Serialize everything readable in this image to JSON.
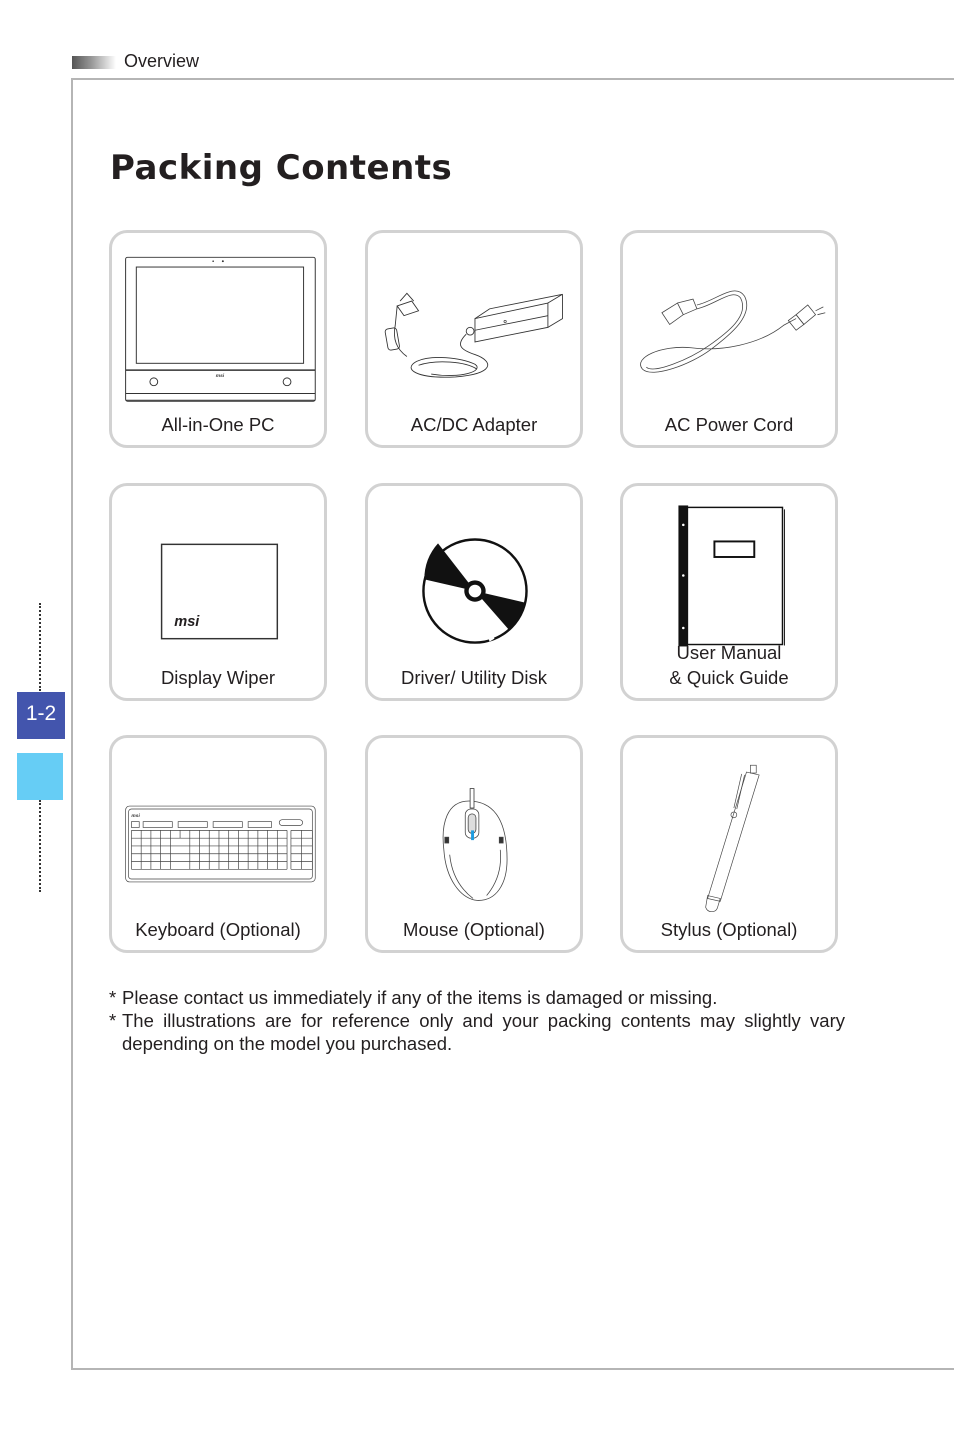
{
  "header": {
    "section_title": "Overview"
  },
  "page": {
    "title": "Packing Contents",
    "page_number": "1-2"
  },
  "items": [
    {
      "label": "All-in-One PC",
      "icon": "all-in-one-pc-icon"
    },
    {
      "label": "AC/DC Adapter",
      "icon": "ac-dc-adapter-icon"
    },
    {
      "label": "AC Power Cord",
      "icon": "ac-power-cord-icon"
    },
    {
      "label": "Display Wiper",
      "icon": "display-wiper-icon",
      "brand_text": "msi"
    },
    {
      "label": "Driver/ Utility Disk",
      "icon": "disk-icon"
    },
    {
      "label_line1": "User Manual",
      "label_line2": "& Quick Guide",
      "icon": "manual-icon"
    },
    {
      "label": "Keyboard (Optional)",
      "icon": "keyboard-icon"
    },
    {
      "label": "Mouse (Optional)",
      "icon": "mouse-icon"
    },
    {
      "label": "Stylus (Optional)",
      "icon": "stylus-icon"
    }
  ],
  "notes": [
    {
      "marker": "*",
      "text": "Please contact us immediately if any of the items is damaged or missing."
    },
    {
      "marker": "*",
      "text": "The illustrations are for reference only and your packing contents may slightly vary depending on the model you purchased."
    }
  ],
  "colors": {
    "page_tab": "#4355ad",
    "page_tab_accent": "#66cdf5",
    "card_border": "#d2d2d2",
    "text": "#231f20"
  }
}
